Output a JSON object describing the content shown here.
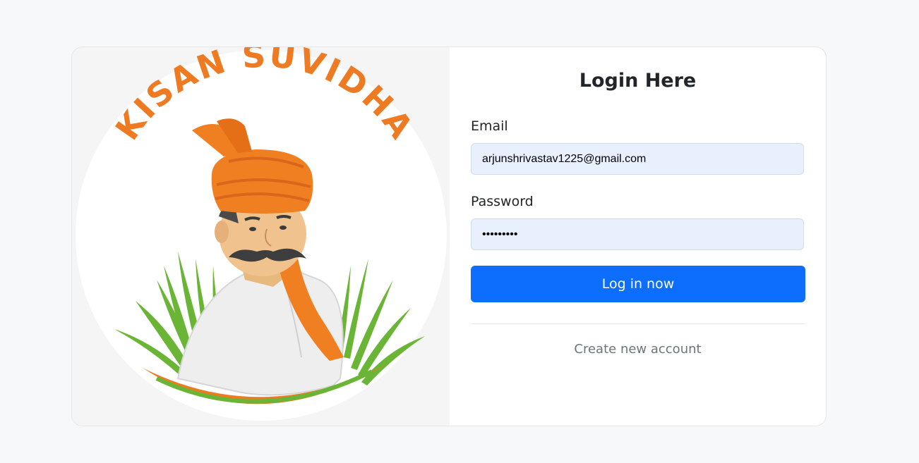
{
  "logo": {
    "brand_text": "KISAN SUVIDHA",
    "icon": "farmer-illustration"
  },
  "login": {
    "title": "Login Here",
    "email_label": "Email",
    "email_value": "arjunshrivastav1225@gmail.com",
    "password_label": "Password",
    "password_value": "secret123",
    "submit_label": "Log in now",
    "create_account_label": "Create new account"
  },
  "colors": {
    "accent": "#0d6efd",
    "brand_orange": "#ee7a22",
    "grass_green": "#6ab536",
    "input_fill": "#e8f0fe"
  }
}
